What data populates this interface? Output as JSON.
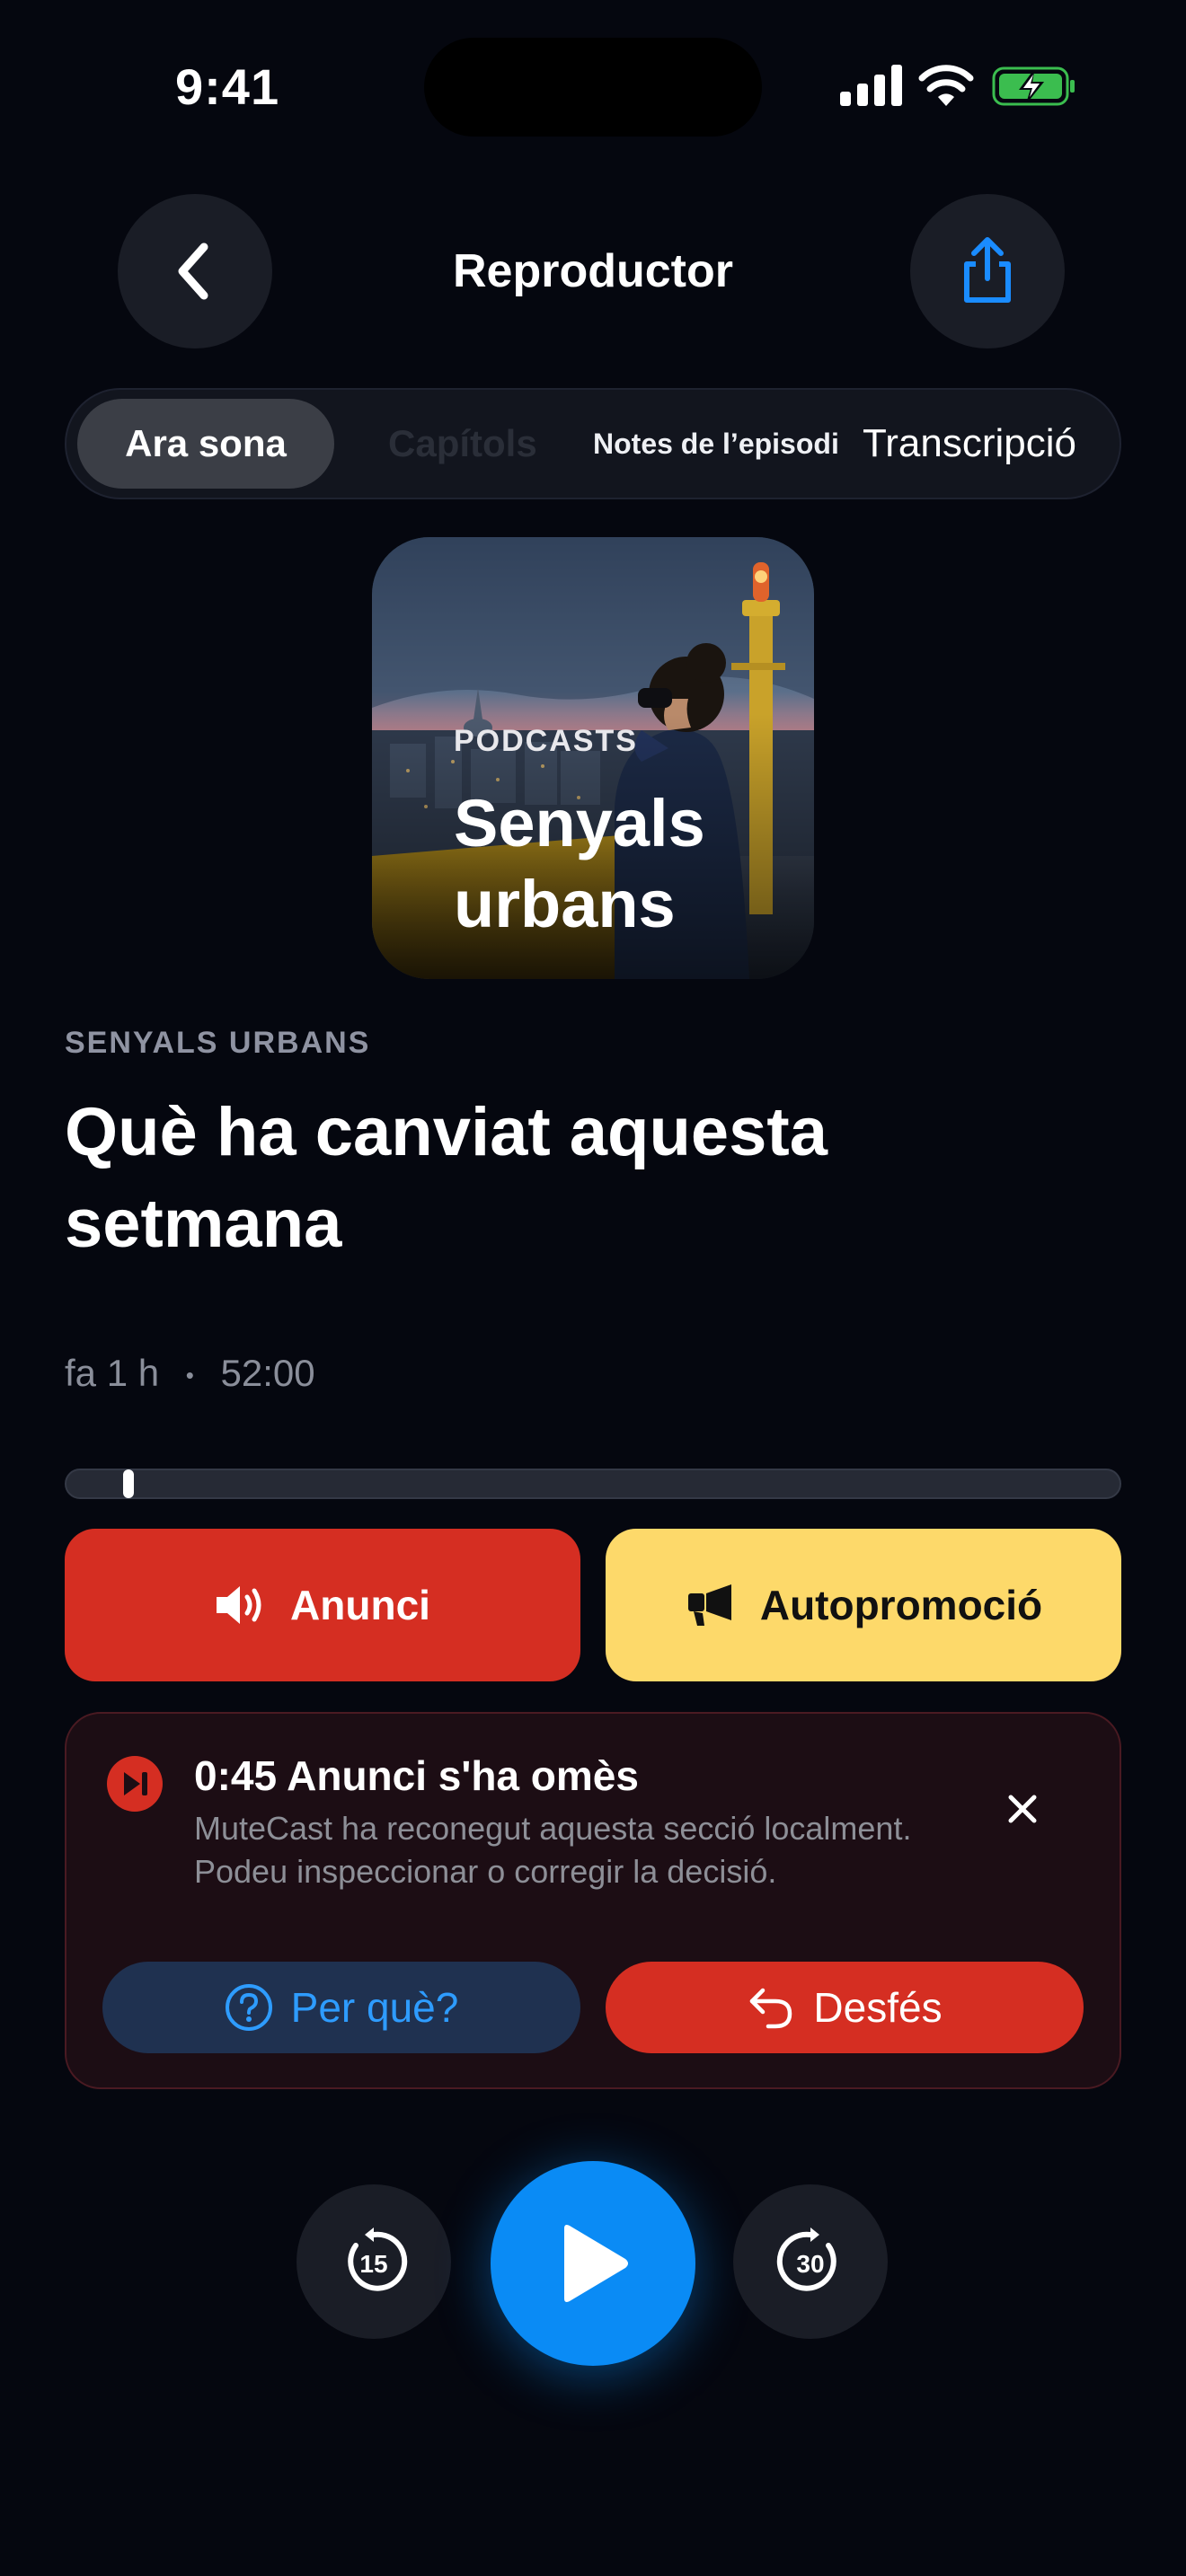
{
  "status_bar": {
    "time": "9:41"
  },
  "nav": {
    "title": "Reproductor"
  },
  "tabs": [
    {
      "label": "Ara sona",
      "selected": true
    },
    {
      "label": "Capítols",
      "selected": false
    },
    {
      "label": "Notes de l’episodi",
      "selected": false
    },
    {
      "label": "Transcripció",
      "selected": false
    }
  ],
  "artwork": {
    "kicker": "PODCASTS",
    "title": "Senyals urbans"
  },
  "episode": {
    "show": "SENYALS URBANS",
    "title": "Què ha canviat aquesta setmana",
    "age": "fa 1 h",
    "separator": "•",
    "duration": "52:00",
    "progress_fraction": 0.04
  },
  "segments": {
    "ad_label": "Anunci",
    "promo_label": "Autopromoció"
  },
  "notice": {
    "title": "0:45 Anunci s'ha omès",
    "body": "MuteCast ha reconegut aquesta secció localment. Podeu inspeccionar o corregir la decisió.",
    "why_label": "Per què?",
    "undo_label": "Desfés"
  },
  "playback": {
    "skip_back_seconds": "15",
    "skip_forward_seconds": "30"
  },
  "colors": {
    "accent": "#0a8bf5",
    "ad_red": "#d52e22",
    "promo_yellow": "#fdd96a",
    "background": "#05070f"
  },
  "icons": {
    "back": "chevron-left-icon",
    "share": "share-icon",
    "ad": "speaker-icon",
    "promo": "megaphone-icon",
    "skipped": "skip-forward-icon",
    "close": "close-icon",
    "why": "question-icon",
    "undo": "undo-icon",
    "play": "play-icon"
  }
}
